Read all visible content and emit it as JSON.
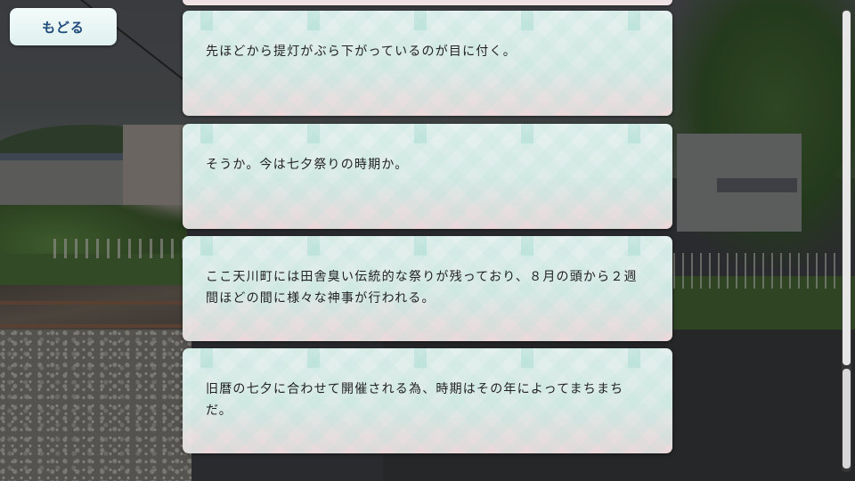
{
  "back_button": {
    "label": "もどる"
  },
  "log_entries": [
    {
      "text": "先ほどから提灯がぶら下がっているのが目に付く。"
    },
    {
      "text": "そうか。今は七夕祭りの時期か。"
    },
    {
      "text": "ここ天川町には田舎臭い伝統的な祭りが残っており、８月の頭から２週間ほどの間に様々な神事が行われる。"
    },
    {
      "text": "旧暦の七夕に合わせて開催される為、時期はその年によってまちまちだ。"
    }
  ],
  "scrollbar": {
    "position_fraction": 0.77
  }
}
